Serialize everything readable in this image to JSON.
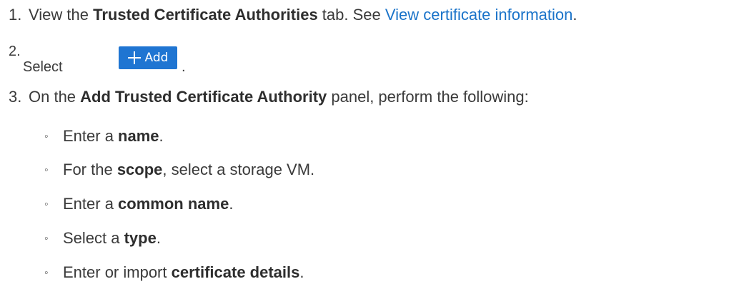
{
  "steps": [
    {
      "number": "1.",
      "prefix": "View the ",
      "bold": "Trusted Certificate Authorities",
      "middle": " tab. See ",
      "link": "View certificate information",
      "suffix": "."
    },
    {
      "number": "2.",
      "text": "Select",
      "button_label": "Add",
      "button_icon": "plus-icon",
      "button_color": "#1f75d2",
      "suffix": "."
    },
    {
      "number": "3.",
      "prefix": "On the ",
      "bold": "Add Trusted Certificate Authority",
      "suffix": " panel, perform the following:"
    }
  ],
  "substeps": [
    {
      "bullet": "◦",
      "prefix": "Enter a ",
      "bold": "name",
      "suffix": "."
    },
    {
      "bullet": "◦",
      "prefix": "For the ",
      "bold": "scope",
      "suffix": ", select a storage VM."
    },
    {
      "bullet": "◦",
      "prefix": "Enter a ",
      "bold": "common name",
      "suffix": "."
    },
    {
      "bullet": "◦",
      "prefix": "Select a ",
      "bold": "type",
      "suffix": "."
    },
    {
      "bullet": "◦",
      "prefix": "Enter or import ",
      "bold": "certificate details",
      "suffix": "."
    }
  ],
  "colors": {
    "text": "#3a3a3a",
    "link": "#1a73c9",
    "button": "#1f75d2"
  }
}
